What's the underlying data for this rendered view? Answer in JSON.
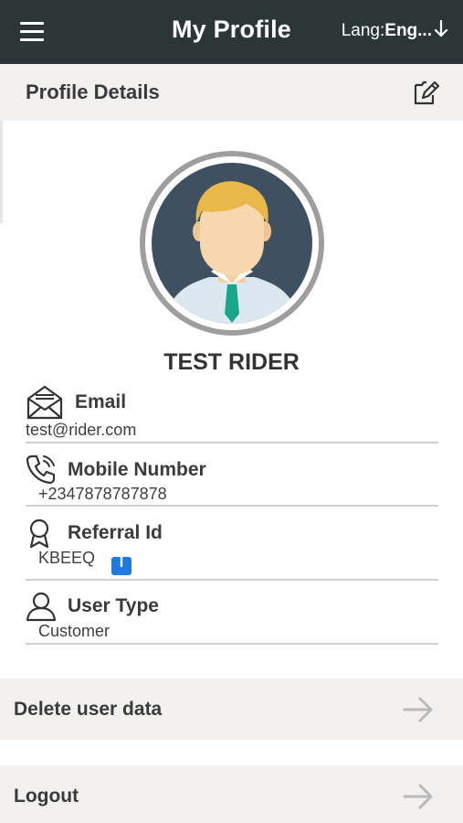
{
  "header": {
    "title": "My Profile",
    "lang_label": "Lang:",
    "lang_value": "Eng...",
    "menu_icon": "hamburger-menu-icon",
    "lang_icon": "arrow-down-icon"
  },
  "profile_section": {
    "title": "Profile Details",
    "edit_icon": "edit-document-icon"
  },
  "user": {
    "name": "TEST RIDER",
    "avatar_icon": "default-male-avatar"
  },
  "fields": {
    "email": {
      "label": "Email",
      "value": "test@rider.com",
      "icon": "envelope-icon"
    },
    "mobile": {
      "label": "Mobile Number",
      "value": "+2347878787878",
      "icon": "phone-icon"
    },
    "referral": {
      "label": "Referral Id",
      "value": "KBEEQ",
      "icon": "award-ribbon-icon",
      "share_icon": "share-icon"
    },
    "user_type": {
      "label": "User Type",
      "value": "Customer",
      "icon": "user-icon"
    }
  },
  "actions": {
    "delete_label": "Delete user data",
    "logout_label": "Logout",
    "arrow_icon": "arrow-right-icon"
  },
  "colors": {
    "topbar": "#2c3637",
    "section_bg": "#f2f1ef",
    "share_blue": "#1f7ae0",
    "divider": "#cfcfcf"
  }
}
